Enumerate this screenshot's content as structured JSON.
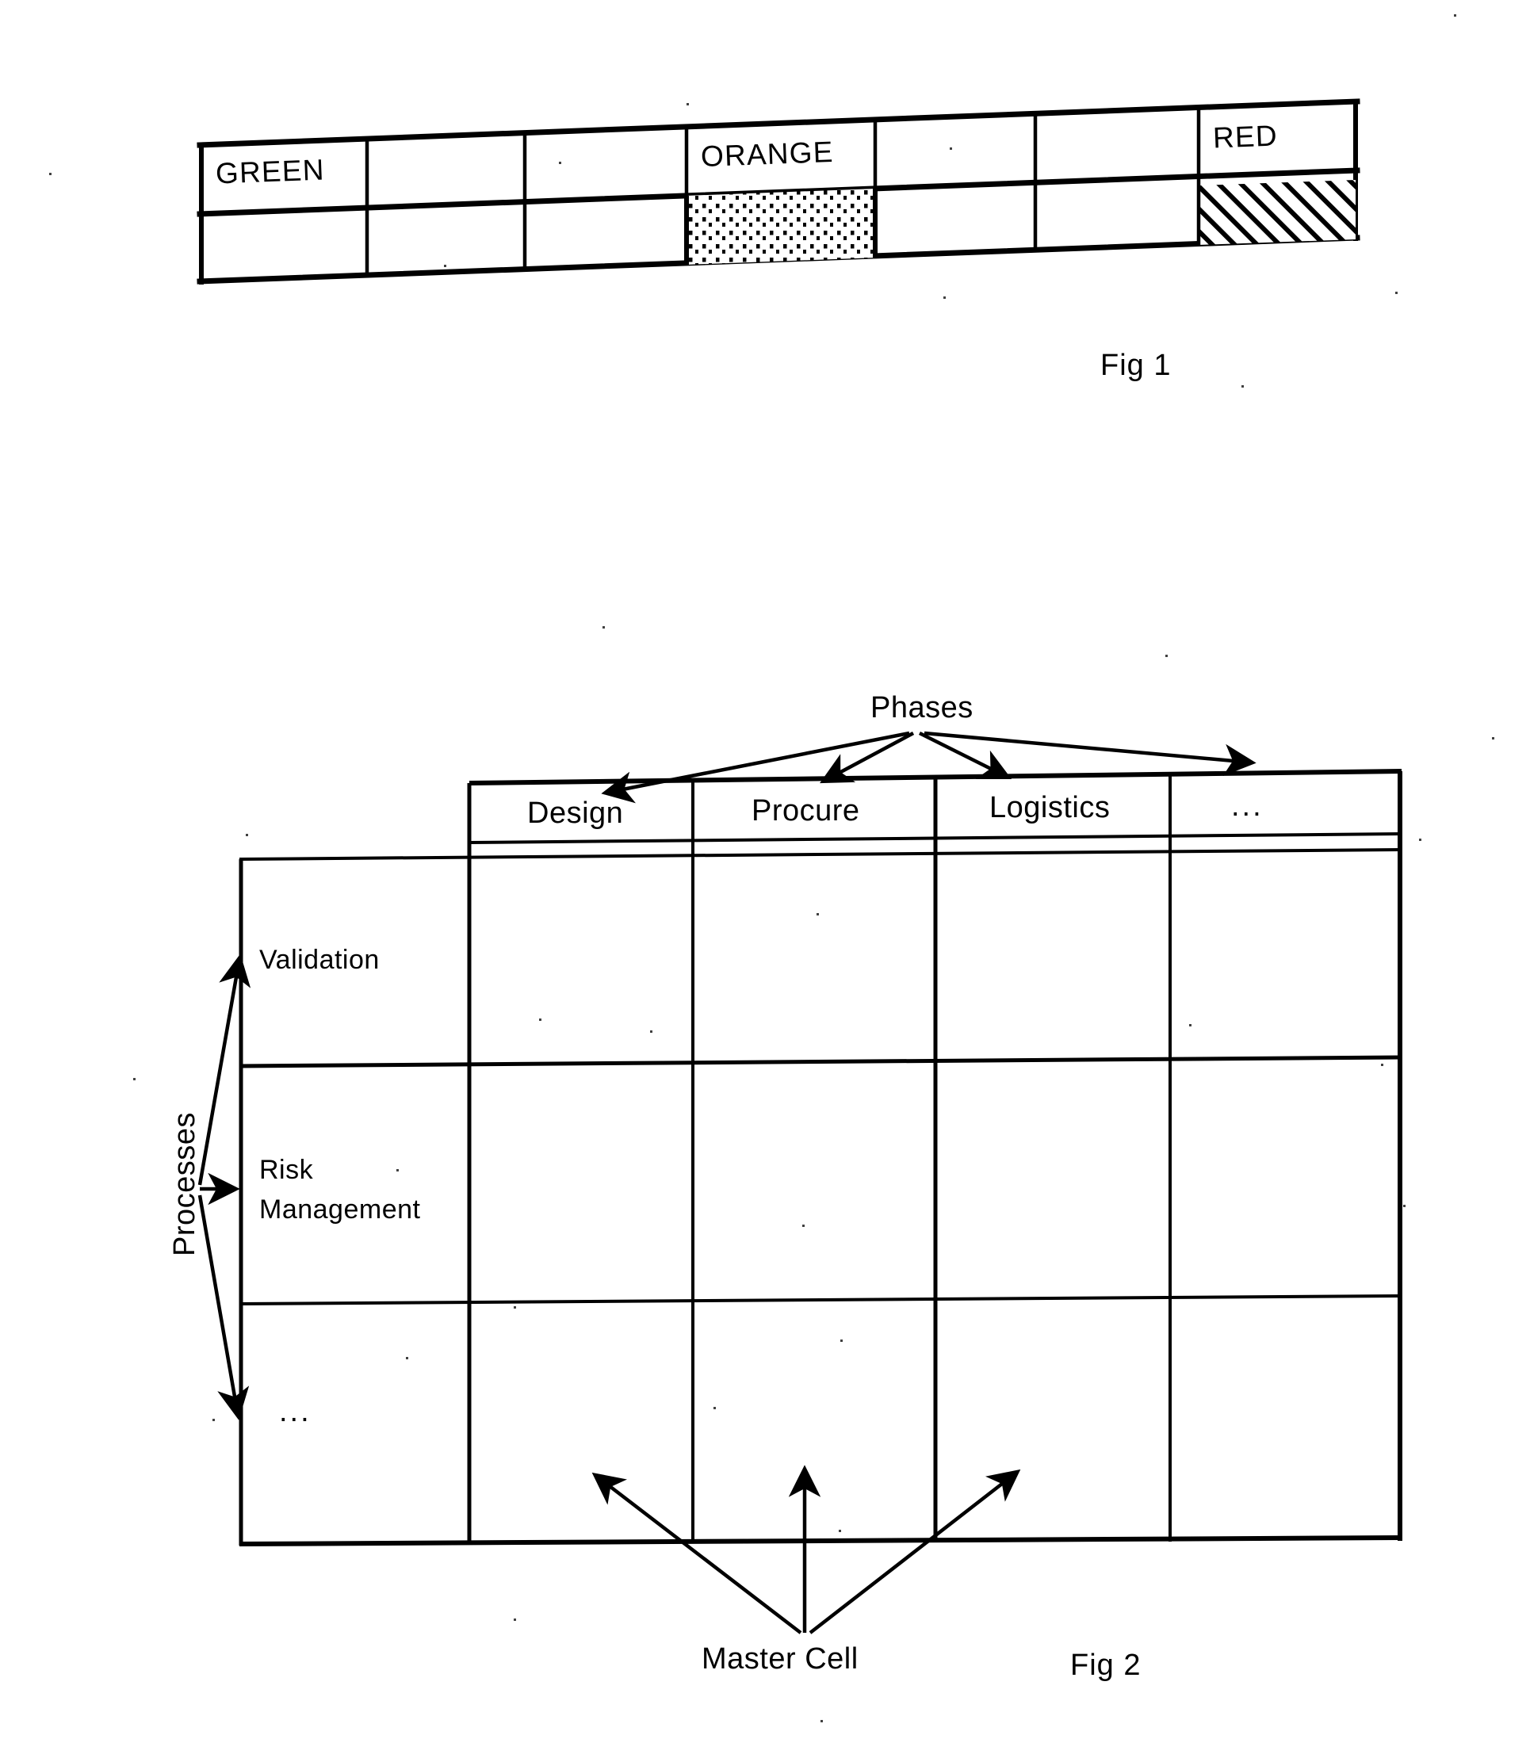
{
  "document": {
    "type": "patent-drawing-sheet",
    "background_color": "#ffffff",
    "ink_color": "#000000"
  },
  "figures": [
    {
      "id": "fig1",
      "caption": "Fig 1",
      "description": "Two-row, seven-column status band table",
      "table": {
        "columns": 7,
        "rows": 2,
        "header_row": [
          "GREEN",
          "",
          "",
          "ORANGE",
          "",
          "",
          "RED"
        ],
        "fill_row": [
          {
            "label": "",
            "fill": "none"
          },
          {
            "label": "",
            "fill": "none"
          },
          {
            "label": "",
            "fill": "none"
          },
          {
            "label": "",
            "fill": "dotted"
          },
          {
            "label": "",
            "fill": "none"
          },
          {
            "label": "",
            "fill": "none"
          },
          {
            "label": "",
            "fill": "diagonal-hatch"
          }
        ]
      }
    },
    {
      "id": "fig2",
      "caption": "Fig 2",
      "description": "Phases by Processes matrix with Master Cell callout",
      "top_axis_label": "Phases",
      "side_axis_label": "Processes",
      "callout_label": "Master Cell",
      "phases": [
        "Design",
        "Procure",
        "Logistics",
        "..."
      ],
      "processes": [
        "Validation",
        "Risk Management",
        "..."
      ],
      "matrix": {
        "columns": 4,
        "rows": 3,
        "cells_empty": true
      },
      "callout_arrow_count": 3,
      "phase_arrow_count": 4,
      "process_arrow_count": 3
    }
  ],
  "fig1_caption": "Fig 1",
  "fig2_caption": "Fig 2",
  "fig1": {
    "c1": "GREEN",
    "c2": "",
    "c3": "",
    "c4": "ORANGE",
    "c5": "",
    "c6": "",
    "c7": "RED"
  },
  "fig2": {
    "phases_label": "Phases",
    "processes_label": "Processes",
    "master_cell_label": "Master Cell",
    "col1": "Design",
    "col2": "Procure",
    "col3": "Logistics",
    "col4": "...",
    "row1": "Validation",
    "row2a": "Risk",
    "row2b": "Management",
    "row3": "..."
  }
}
